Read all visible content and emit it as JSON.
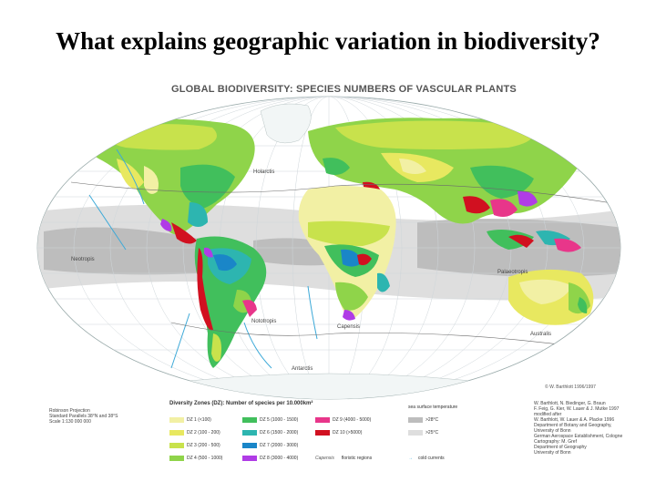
{
  "slide": {
    "title": "What explains geographic variation in biodiversity?"
  },
  "map": {
    "heading": "GLOBAL BIODIVERSITY:  SPECIES NUMBERS OF VASCULAR PLANTS",
    "copyright": "© W. Barthlott 1996/1997",
    "region_labels": {
      "holarctis": "Holarctis",
      "neotropis": "Neotropis",
      "palaeotropis": "Palaeotropis",
      "nototropis": "Nototropis",
      "capensis": "Capensis",
      "australis": "Australis",
      "antarctis": "Antarctis"
    },
    "colors": {
      "ocean": "#ffffff",
      "graticule": "#cfd6da",
      "desert": "#f2f0a4",
      "dz2": "#e8e860",
      "dz3": "#c8e24c",
      "dz4": "#8fd44a",
      "dz5": "#41bf5c",
      "dz6": "#2db5b0",
      "dz7": "#1a86c8",
      "dz8": "#b03ce6",
      "dz9": "#e8368a",
      "dz10": "#d11020",
      "band_dark": "#bdbdbd",
      "band_light": "#dedede",
      "ice": "#f2f6f6",
      "currents": "#3da9d8"
    }
  },
  "legend": {
    "projection": [
      "Robinson Projection",
      "Standard Parallels 38°N and 38°S",
      "Scale 1:130 000 000"
    ],
    "title": "Diversity Zones (DZ): Number of species per 10.000km²",
    "zones": [
      {
        "label": "DZ 1   (<100)",
        "color": "#f2f0a4"
      },
      {
        "label": "DZ 2   (100 - 200)",
        "color": "#e8e860"
      },
      {
        "label": "DZ 3   (200 - 500)",
        "color": "#c8e24c"
      },
      {
        "label": "DZ 4   (500 - 1000)",
        "color": "#8fd44a"
      },
      {
        "label": "DZ 5 (1000 - 1500)",
        "color": "#41bf5c"
      },
      {
        "label": "DZ 6 (1500 - 2000)",
        "color": "#2db5b0"
      },
      {
        "label": "DZ 7 (2000 - 3000)",
        "color": "#1a86c8"
      },
      {
        "label": "DZ 8 (3000 - 4000)",
        "color": "#b03ce6"
      },
      {
        "label": "DZ 9 (4000 - 5000)",
        "color": "#e8368a"
      },
      {
        "label": "DZ 10 (>5000)",
        "color": "#d11020"
      }
    ],
    "sea_temp_note": "sea surface temperature",
    "sea_temps": [
      {
        "label": ">28°C",
        "color": "#bdbdbd"
      },
      {
        "label": ">25°C",
        "color": "#dedede"
      }
    ],
    "floristic_label": "floristic regions",
    "floristic_example": "Capensis",
    "currents_label": "cold currents",
    "credits": [
      "W. Barthlott, N. Biedinger, G. Braun",
      "F. Feig, G. Kier, W. Lauer & J. Mutke 1997",
      "modified after",
      "W. Barthlott, W. Lauer & A. Placke 1996",
      "Department of Botany and Geography,",
      "University of Bonn",
      "German Aerospace Establishment, Cologne",
      "Cartography: M. Gref",
      "Department of Geography",
      "University of Bonn"
    ]
  }
}
